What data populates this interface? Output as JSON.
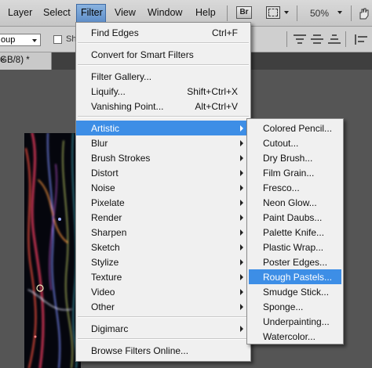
{
  "menubar": {
    "items": [
      "Layer",
      "Select",
      "Filter",
      "View",
      "Window",
      "Help"
    ],
    "active": "Filter",
    "bridge_label": "Br",
    "layout_icon": "screen-layout-icon",
    "zoom": "50%"
  },
  "options_bar": {
    "auto_select_value": "oup",
    "checkbox_label": "Sh",
    "align_icons": [
      "align-top-icon",
      "align-vcenter-icon",
      "align-bottom-icon",
      "align-left-icon"
    ]
  },
  "document_tab": {
    "title": "GB/8) *",
    "close_label": "×"
  },
  "filter_menu": {
    "items": [
      {
        "label": "Find Edges",
        "shortcut": "Ctrl+F"
      },
      {
        "label": "Convert for Smart Filters"
      },
      {
        "label": "Filter Gallery..."
      },
      {
        "label": "Liquify...",
        "shortcut": "Shift+Ctrl+X"
      },
      {
        "label": "Vanishing Point...",
        "shortcut": "Alt+Ctrl+V"
      },
      {
        "label": "Artistic",
        "submenu": true,
        "highlighted": true
      },
      {
        "label": "Blur",
        "submenu": true
      },
      {
        "label": "Brush Strokes",
        "submenu": true
      },
      {
        "label": "Distort",
        "submenu": true
      },
      {
        "label": "Noise",
        "submenu": true
      },
      {
        "label": "Pixelate",
        "submenu": true
      },
      {
        "label": "Render",
        "submenu": true
      },
      {
        "label": "Sharpen",
        "submenu": true
      },
      {
        "label": "Sketch",
        "submenu": true
      },
      {
        "label": "Stylize",
        "submenu": true
      },
      {
        "label": "Texture",
        "submenu": true
      },
      {
        "label": "Video",
        "submenu": true
      },
      {
        "label": "Other",
        "submenu": true
      },
      {
        "label": "Digimarc",
        "submenu": true
      },
      {
        "label": "Browse Filters Online..."
      }
    ]
  },
  "artistic_submenu": {
    "items": [
      {
        "label": "Colored Pencil..."
      },
      {
        "label": "Cutout..."
      },
      {
        "label": "Dry Brush..."
      },
      {
        "label": "Film Grain..."
      },
      {
        "label": "Fresco..."
      },
      {
        "label": "Neon Glow..."
      },
      {
        "label": "Paint Daubs..."
      },
      {
        "label": "Palette Knife..."
      },
      {
        "label": "Plastic Wrap..."
      },
      {
        "label": "Poster Edges..."
      },
      {
        "label": "Rough Pastels...",
        "highlighted": true
      },
      {
        "label": "Smudge Stick..."
      },
      {
        "label": "Sponge..."
      },
      {
        "label": "Underpainting..."
      },
      {
        "label": "Watercolor..."
      }
    ]
  },
  "colors": {
    "highlight": "#3d8ee6",
    "menu_bg": "#f0f0f0",
    "menubar_bg": "#d0d0d0",
    "workspace_bg": "#555555"
  }
}
